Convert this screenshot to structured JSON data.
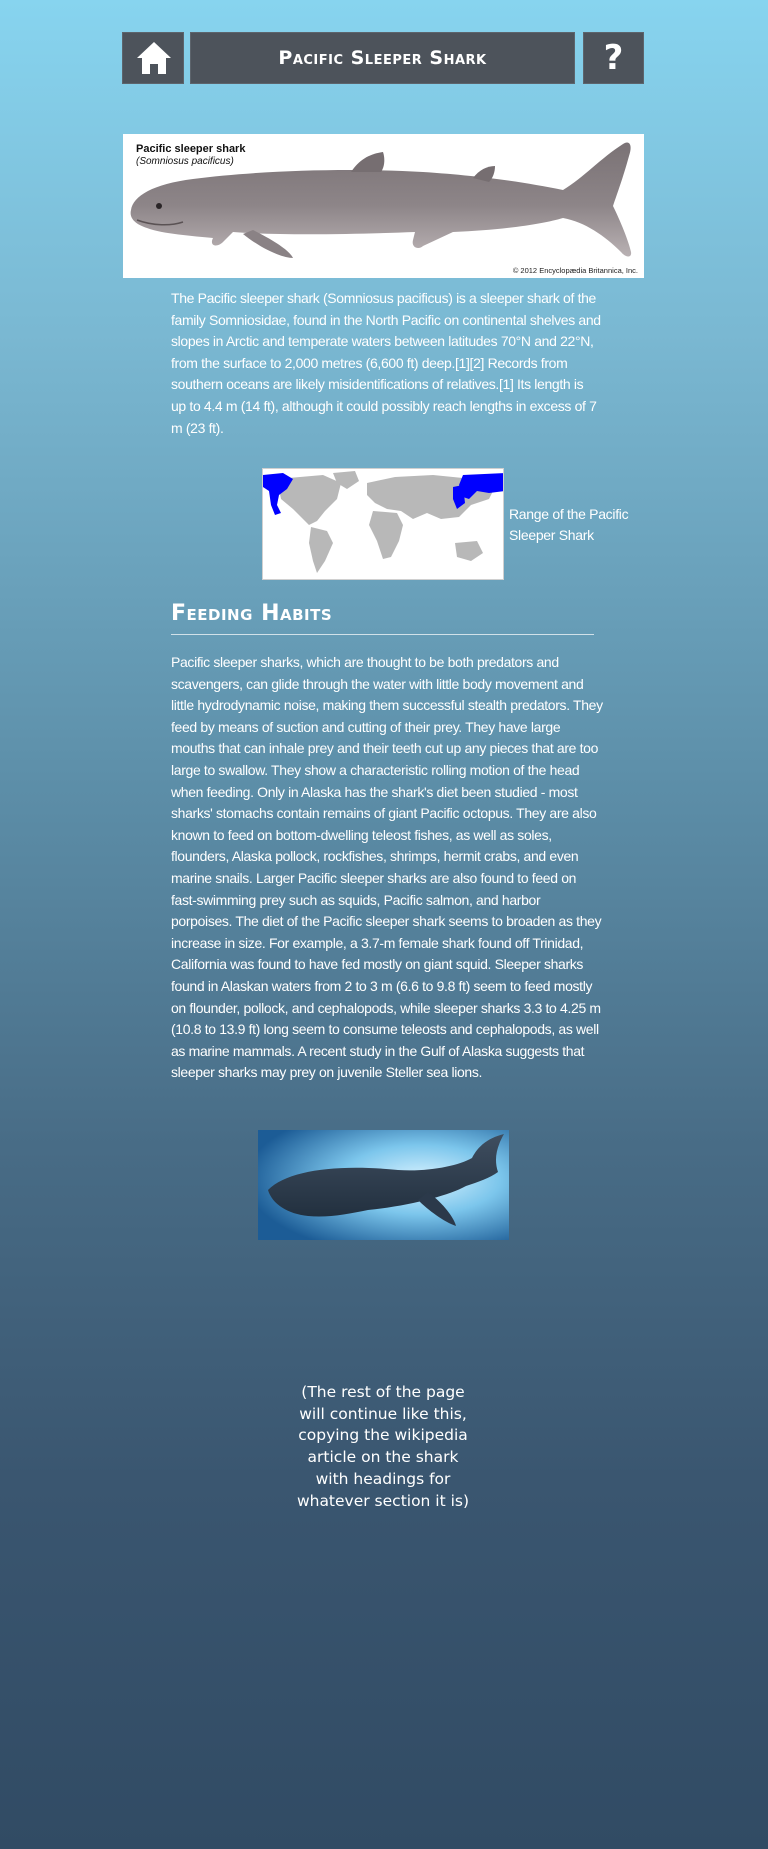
{
  "header": {
    "home_icon": "home-icon",
    "title": "Pacific Sleeper Shark",
    "help_label": "?"
  },
  "hero_image": {
    "title": "Pacific sleeper shark",
    "subtitle": "(Somniosus pacificus)",
    "credit": "© 2012 Encyclopædia Britannica, Inc."
  },
  "intro": {
    "text": "The Pacific sleeper shark (Somniosus pacificus) is a sleeper shark of the family Somniosidae, found in the North Pacific on continental shelves and slopes in Arctic and temperate waters between latitudes 70°N and 22°N, from the surface to 2,000 metres (6,600 ft) deep.[1][2] Records from southern oceans are likely misidentifications of relatives.[1] Its length is up to 4.4 m (14 ft), although it could possibly reach lengths in excess of 7 m (23 ft)."
  },
  "range_map": {
    "caption": "Range of the Pacific Sleeper Shark",
    "colors": {
      "land": "#b8b8b8",
      "range": "#0000ff",
      "sea": "#ffffff"
    }
  },
  "feeding": {
    "heading": "Feeding Habits",
    "text": "Pacific sleeper sharks, which are thought to be both predators and scavengers, can glide through the water with little body movement and little hydrodynamic noise, making them successful stealth predators. They feed by means of suction and cutting of their prey. They have large mouths that can inhale prey and their teeth cut up any pieces that are too large to swallow. They show a characteristic rolling motion of the head when feeding. Only in Alaska has the shark's diet been studied - most sharks' stomachs contain remains of giant Pacific octopus. They are also known to feed on bottom-dwelling teleost fishes, as well as soles, flounders, Alaska pollock, rockfishes, shrimps, hermit crabs, and even marine snails. Larger Pacific sleeper sharks are also found to feed on fast-swimming prey such as squids, Pacific salmon, and harbor porpoises. The diet of the Pacific sleeper shark seems to broaden as they increase in size. For example, a 3.7-m female shark found off Trinidad, California was found to have fed mostly on giant squid. Sleeper sharks found in Alaskan waters from 2 to 3 m (6.6 to 9.8 ft) seem to feed mostly on flounder, pollock, and cephalopods, while sleeper sharks 3.3 to 4.25 m (10.8 to 13.9 ft) long seem to consume teleosts and cephalopods, as well as marine mammals. A recent study in the Gulf of Alaska suggests that sleeper sharks may prey on juvenile Steller sea lions."
  },
  "placeholder_note": {
    "text": "(The rest of the page will continue like this, copying the wikipedia article on the shark with headings for whatever section it is)"
  },
  "colors": {
    "bar": "#4d535b",
    "gradient_top": "#87d4ef",
    "gradient_bottom": "#314b64"
  }
}
